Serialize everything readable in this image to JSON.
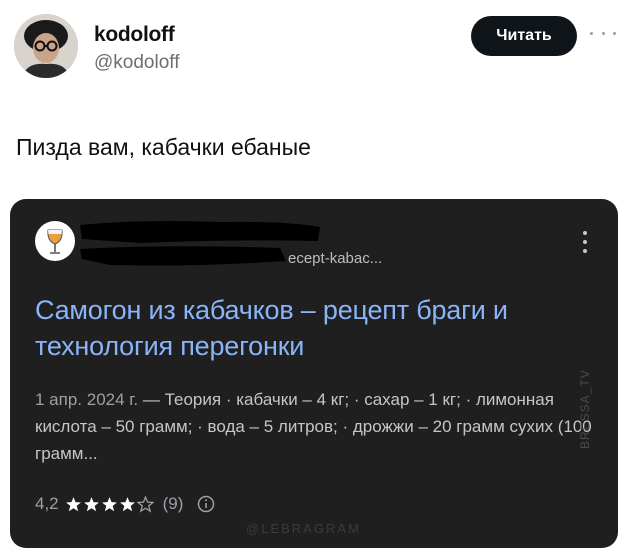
{
  "tweet": {
    "display_name": "kodoloff",
    "handle": "@kodoloff",
    "follow_label": "Читать",
    "text": "Пизда вам, кабачки ебаные"
  },
  "card": {
    "url": "ecept-kabac...",
    "title": "Самогон из кабачков – рецепт браги и технология перегонки",
    "date": "1 апр. 2024 г.",
    "snippet": "— Теория · кабачки – 4 кг; · сахар – 1 кг; · лимонная кислота – 50 грамм; · вода – 5 литров; · дрожжи – 20 грамм сухих (100 грамм...",
    "rating_value": "4,2",
    "rating_stars": 4.2,
    "review_count": "(9)",
    "watermark_bottom": "@LEBRAGRAM",
    "watermark_side": "BRESSA_TV"
  },
  "colors": {
    "follow_button": "#0f1419",
    "card_background": "#1f1f1f",
    "link_title": "#8ab4f8",
    "snippet_text": "#c4c7c5",
    "muted_text": "#9aa0a6",
    "star": "#ffffff"
  },
  "icons": {
    "more": "more-horizontal-icon",
    "site": "wine-glass-icon",
    "card_menu": "more-vertical-icon",
    "info": "info-icon",
    "star": "star-icon"
  }
}
